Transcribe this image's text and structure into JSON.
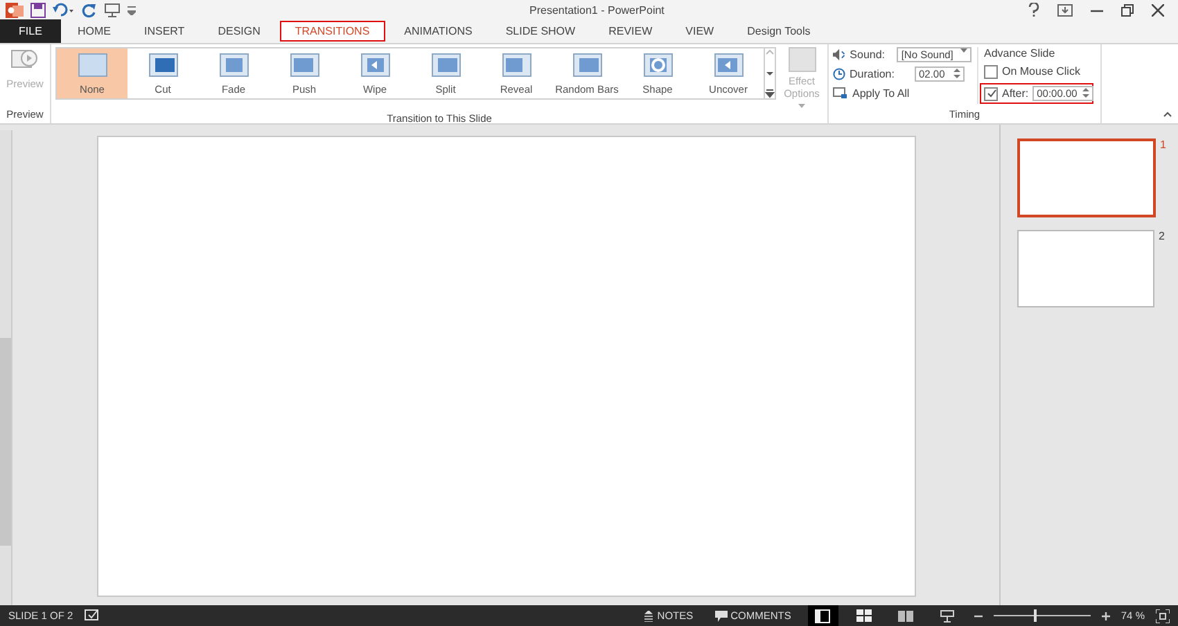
{
  "window": {
    "title": "Presentation1 - PowerPoint"
  },
  "tabs": [
    {
      "label": "FILE",
      "kind": "file",
      "selected": false,
      "highlighted": false
    },
    {
      "label": "HOME",
      "kind": "tab",
      "selected": false,
      "highlighted": false
    },
    {
      "label": "INSERT",
      "kind": "tab",
      "selected": false,
      "highlighted": false
    },
    {
      "label": "DESIGN",
      "kind": "tab",
      "selected": false,
      "highlighted": false
    },
    {
      "label": "TRANSITIONS",
      "kind": "tab",
      "selected": true,
      "highlighted": true
    },
    {
      "label": "ANIMATIONS",
      "kind": "tab",
      "selected": false,
      "highlighted": false
    },
    {
      "label": "SLIDE SHOW",
      "kind": "tab",
      "selected": false,
      "highlighted": false
    },
    {
      "label": "REVIEW",
      "kind": "tab",
      "selected": false,
      "highlighted": false
    },
    {
      "label": "VIEW",
      "kind": "tab",
      "selected": false,
      "highlighted": false
    },
    {
      "label": "Design Tools",
      "kind": "context",
      "selected": false,
      "highlighted": false
    }
  ],
  "ribbon": {
    "preview": {
      "label": "Preview",
      "group": "Preview"
    },
    "transitions": [
      {
        "label": "None",
        "selected": true
      },
      {
        "label": "Cut",
        "selected": false
      },
      {
        "label": "Fade",
        "selected": false
      },
      {
        "label": "Push",
        "selected": false
      },
      {
        "label": "Wipe",
        "selected": false
      },
      {
        "label": "Split",
        "selected": false
      },
      {
        "label": "Reveal",
        "selected": false
      },
      {
        "label": "Random Bars",
        "selected": false
      },
      {
        "label": "Shape",
        "selected": false
      },
      {
        "label": "Uncover",
        "selected": false
      }
    ],
    "transitions_group": "Transition to This Slide",
    "effect_options": "Effect Options",
    "timing": {
      "sound_label": "Sound:",
      "sound_value": "[No Sound]",
      "duration_label": "Duration:",
      "duration_value": "02.00",
      "apply_all": "Apply To All",
      "advance_title": "Advance Slide",
      "on_mouse_click": {
        "label": "On Mouse Click",
        "checked": false
      },
      "after": {
        "label": "After:",
        "checked": true,
        "value": "00:00.00",
        "highlighted": true
      },
      "group": "Timing"
    }
  },
  "slides": [
    {
      "number": "1",
      "selected": true
    },
    {
      "number": "2",
      "selected": false
    }
  ],
  "status_bar": {
    "slide_count": "SLIDE 1 OF 2",
    "notes": "NOTES",
    "comments": "COMMENTS",
    "views": [
      {
        "selected": true
      },
      {
        "selected": false
      },
      {
        "selected": false
      },
      {
        "selected": false
      }
    ],
    "level": 0.42,
    "zoom": "74 %"
  }
}
